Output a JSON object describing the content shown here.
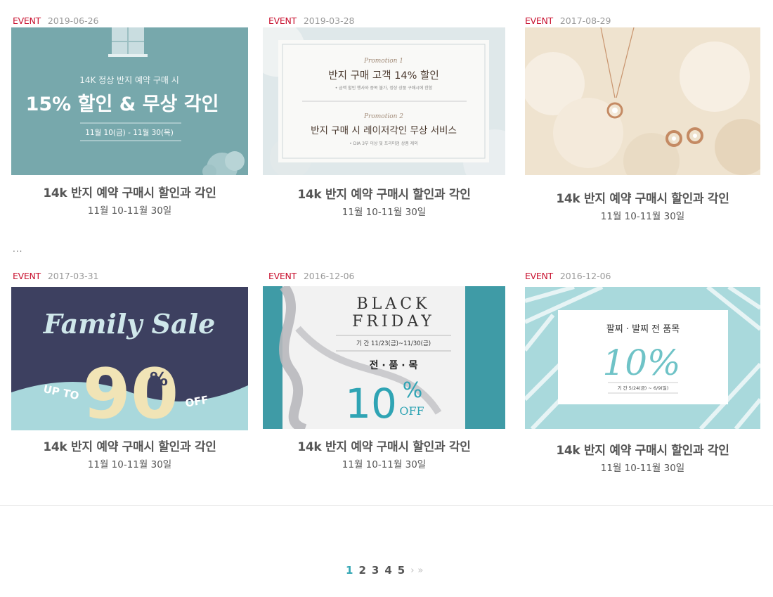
{
  "cards": [
    {
      "tag": "EVENT",
      "date": "2019-06-26",
      "title": "14k  반지 예약 구매시 할인과 각인",
      "period": "11월 10-11월 30일",
      "banner": {
        "line1": "14K 정상 반지 예약 구매 시",
        "headline": "15% 할인 & 무상 각인",
        "dates": "11월 10(금) - 11월 30(목)"
      }
    },
    {
      "tag": "EVENT",
      "date": "2019-03-28",
      "title": "14k  반지 예약 구매시 할인과 각인",
      "period": "11월 10-11월 30일",
      "banner": {
        "promo1": "Promotion 1",
        "line1": "반지 구매 고객 14% 할인",
        "note1": "• 금액 할인 행사와 중복 불가, 정상 상품 구매시에 한함",
        "promo2": "Promotion 2",
        "line2": "반지 구매 시 레이저각인 무상 서비스",
        "note2": "• DIA 3부 이상 및 프리미엄 상품 제외"
      }
    },
    {
      "tag": "EVENT",
      "date": "2017-08-29",
      "title": "14k  반지 예약 구매시 할인과 각인",
      "period": "11월 10-11월 30일"
    },
    {
      "tag": "EVENT",
      "date": "2017-03-31",
      "title": "14k  반지 예약 구매시 할인과 각인",
      "period": "11월 10-11월 30일",
      "banner": {
        "headline": "Family Sale",
        "upto": "UP TO",
        "number": "90",
        "percent": "%",
        "off": "OFF"
      }
    },
    {
      "tag": "EVENT",
      "date": "2016-12-06",
      "title": "14k  반지 예약 구매시 할인과 각인",
      "period": "11월 10-11월 30일",
      "banner": {
        "line1": "BLACK",
        "line2": "FRIDAY",
        "period": "기 간  11/23(금)~11/30(금)",
        "scope": "전 · 품 · 목",
        "number": "10",
        "percent": "%",
        "off": "OFF"
      }
    },
    {
      "tag": "EVENT",
      "date": "2016-12-06",
      "title": "14k  반지 예약 구매시 할인과 각인",
      "period": "11월 10-11월 30일",
      "banner": {
        "line1": "팔찌 · 발찌 전 품목",
        "number": "10%",
        "period": "기 간  5/24(금) ~ 6/9(일)"
      }
    }
  ],
  "ellipsis": "...",
  "pagination": {
    "pages": [
      "1",
      "2",
      "3",
      "4",
      "5"
    ],
    "next": "›",
    "last": "»",
    "current": "1"
  },
  "colors": {
    "event_red": "#c8102e",
    "accent_teal": "#35a7b4"
  }
}
